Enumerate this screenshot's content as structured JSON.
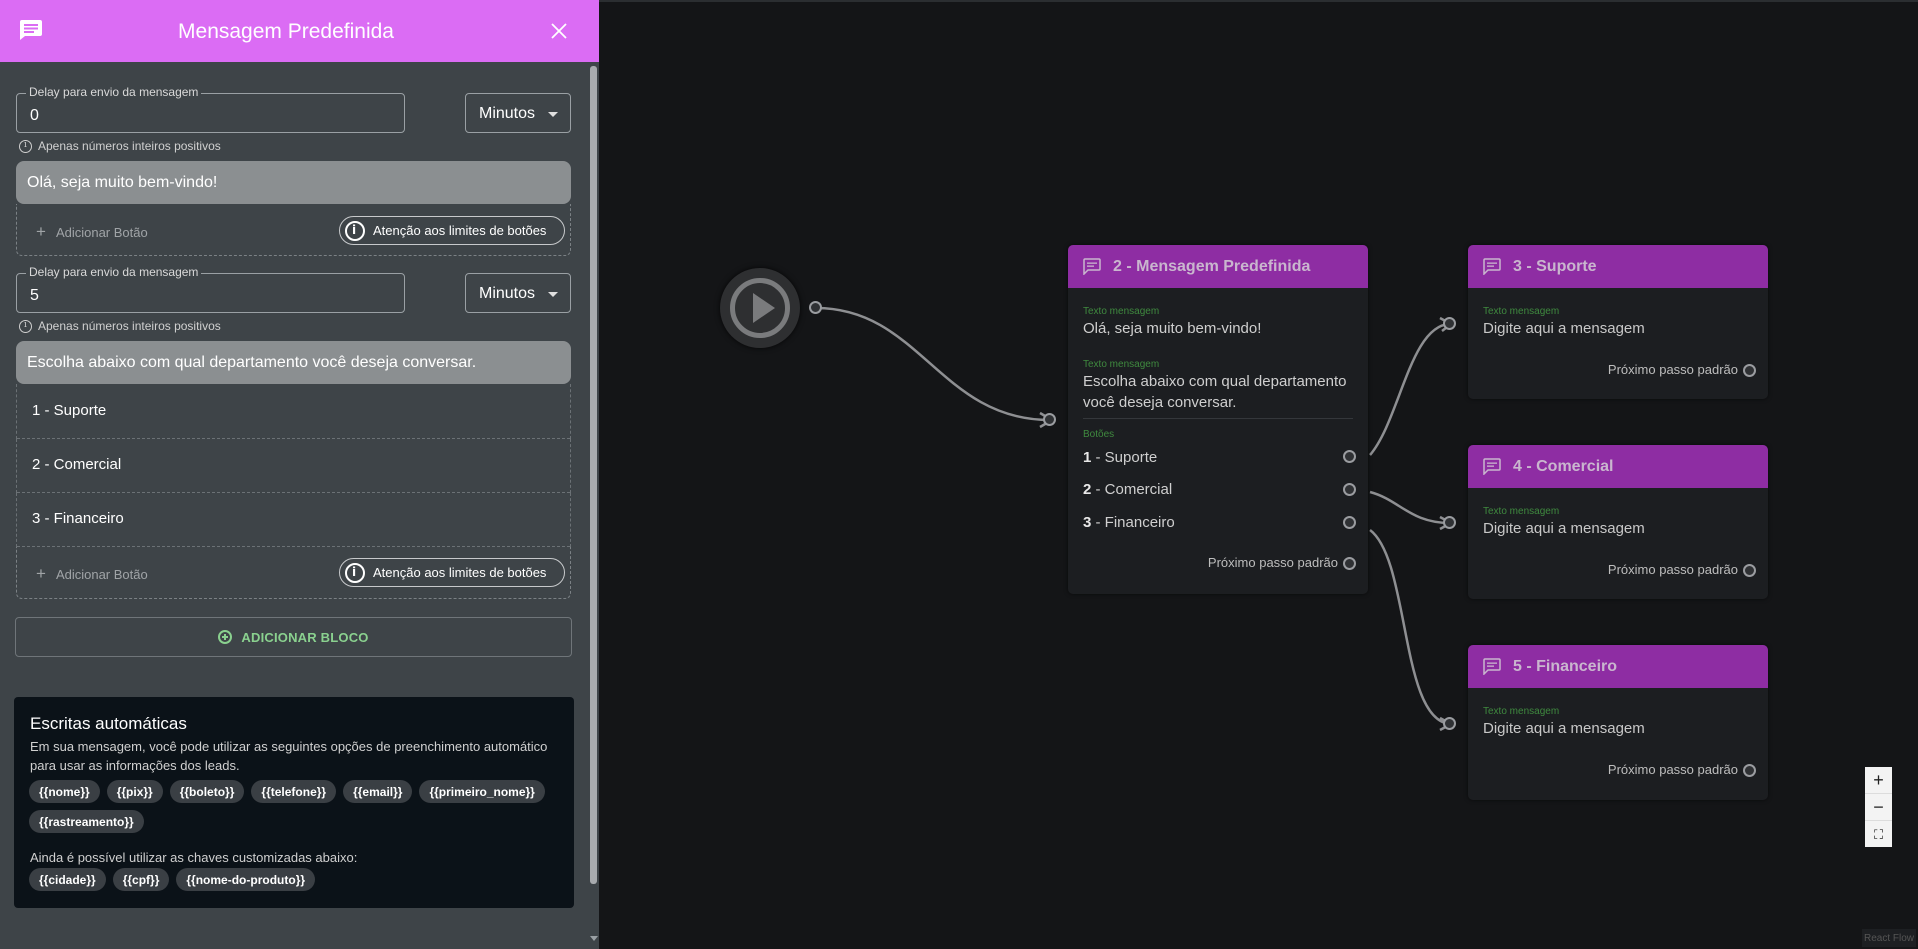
{
  "panel": {
    "title": "Mensagem Predefinida",
    "blocks": [
      {
        "delay_label": "Delay para envio da mensagem",
        "delay_value": "0",
        "unit": "Minutos",
        "hint": "Apenas números inteiros positivos",
        "message": "Olá, seja muito bem-vindo!",
        "buttons": [],
        "add_button_label": "Adicionar Botão",
        "limits_label": "Atenção aos limites de botões"
      },
      {
        "delay_label": "Delay para envio da mensagem",
        "delay_value": "5",
        "unit": "Minutos",
        "hint": "Apenas números inteiros positivos",
        "message": "Escolha abaixo com qual departamento você deseja conversar.",
        "buttons": [
          "1 - Suporte",
          "2 - Comercial",
          "3 - Financeiro"
        ],
        "add_button_label": "Adicionar Botão",
        "limits_label": "Atenção aos limites de botões"
      }
    ],
    "add_block_label": "ADICIONAR BLOCO",
    "auto": {
      "title": "Escritas automáticas",
      "description": "Em sua mensagem, você pode utilizar as seguintes opções de preenchimento automático para usar as informações dos leads.",
      "chips": [
        "{{nome}}",
        "{{pix}}",
        "{{boleto}}",
        "{{telefone}}",
        "{{email}}",
        "{{primeiro_nome}}",
        "{{rastreamento}}"
      ],
      "custom_label": "Ainda é possível utilizar as chaves customizadas abaixo:",
      "custom_chips": [
        "{{cidade}}",
        "{{cpf}}",
        "{{nome-do-produto}}"
      ]
    }
  },
  "flow": {
    "main_node": {
      "title": "2 - Mensagem Predefinida",
      "text_label": "Texto mensagem",
      "message1": "Olá, seja muito bem-vindo!",
      "message2_line1": "Escolha abaixo com qual departamento",
      "message2_line2": "você deseja conversar.",
      "buttons_label": "Botões",
      "buttons": [
        {
          "num": "1",
          "label": " - Suporte"
        },
        {
          "num": "2",
          "label": " - Comercial"
        },
        {
          "num": "3",
          "label": " - Financeiro"
        }
      ],
      "default_step": "Próximo passo padrão"
    },
    "targets": [
      {
        "title": "3 - Suporte",
        "text_label": "Texto mensagem",
        "placeholder": "Digite aqui a mensagem",
        "default_step": "Próximo passo padrão"
      },
      {
        "title": "4 - Comercial",
        "text_label": "Texto mensagem",
        "placeholder": "Digite aqui a mensagem",
        "default_step": "Próximo passo padrão"
      },
      {
        "title": "5 - Financeiro",
        "text_label": "Texto mensagem",
        "placeholder": "Digite aqui a mensagem",
        "default_step": "Próximo passo padrão"
      }
    ],
    "controls": {
      "zoom_in": "+",
      "zoom_out": "−",
      "fit": "⛶"
    },
    "attribution": "React Flow"
  },
  "colors": {
    "header": "#db6cf4",
    "node_header": "#8e2da3",
    "accent_green": "#8ad18f",
    "panel_bg": "#3e4448",
    "canvas_bg": "#141517"
  },
  "icons": {
    "header": "chat-icon",
    "close": "close-icon",
    "node": "chat-outline-icon",
    "start": "play-icon"
  }
}
